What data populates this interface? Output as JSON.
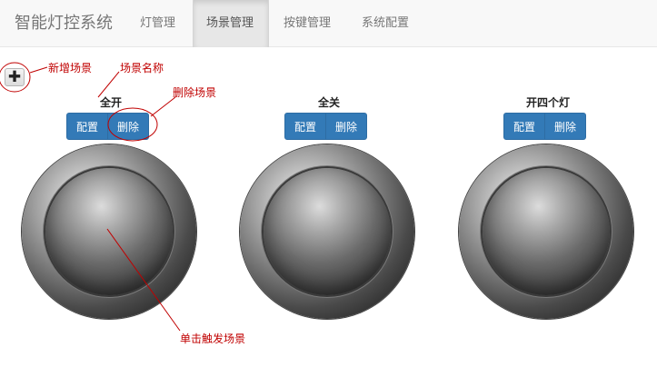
{
  "navbar": {
    "brand": "智能灯控系统",
    "items": [
      {
        "label": "灯管理",
        "active": false
      },
      {
        "label": "场景管理",
        "active": true
      },
      {
        "label": "按键管理",
        "active": false
      },
      {
        "label": "系统配置",
        "active": false
      }
    ]
  },
  "toolbar": {
    "add_icon": "plus-icon"
  },
  "scenes": [
    {
      "name": "全开",
      "config_label": "配置",
      "delete_label": "删除"
    },
    {
      "name": "全关",
      "config_label": "配置",
      "delete_label": "删除"
    },
    {
      "name": "开四个灯",
      "config_label": "配置",
      "delete_label": "删除"
    }
  ],
  "annotations": {
    "add_scene": "新增场景",
    "scene_name": "场景名称",
    "delete_scene": "删除场景",
    "trigger_scene": "单击触发场景"
  },
  "colors": {
    "primary": "#337ab7",
    "annotation": "#c00000"
  }
}
